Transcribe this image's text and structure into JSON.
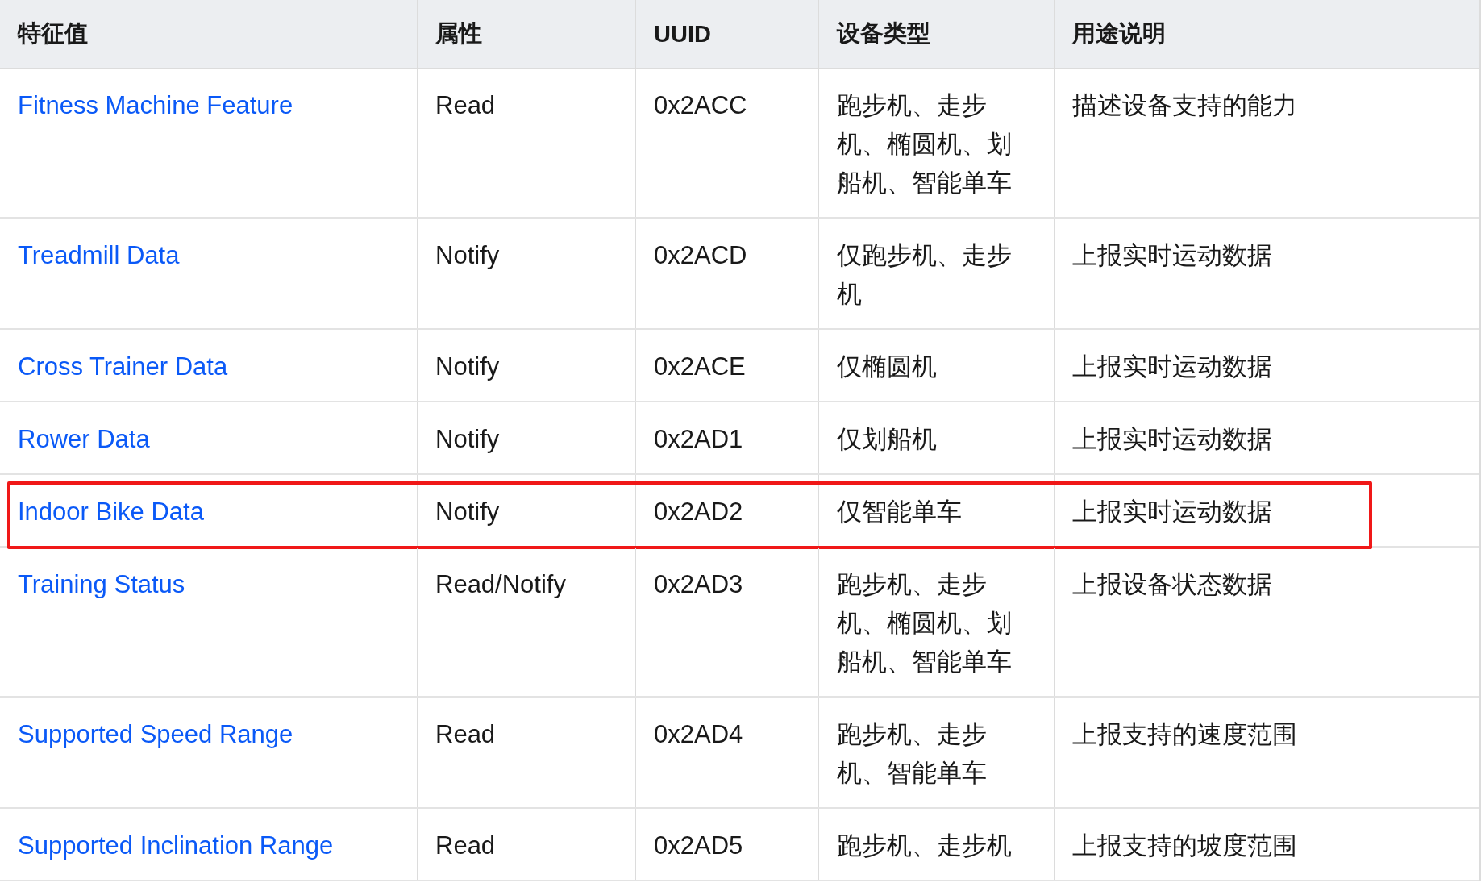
{
  "table": {
    "columns": [
      "特征值",
      "属性",
      "UUID",
      "设备类型",
      "用途说明"
    ],
    "rows": [
      {
        "name": "Fitness Machine Feature",
        "property": "Read",
        "uuid": "0x2ACC",
        "devices": "跑步机、走步机、椭圆机、划船机、智能单车",
        "purpose": "描述设备支持的能力",
        "highlighted": false
      },
      {
        "name": "Treadmill Data",
        "property": "Notify",
        "uuid": "0x2ACD",
        "devices": "仅跑步机、走步机",
        "purpose": "上报实时运动数据",
        "highlighted": false
      },
      {
        "name": "Cross Trainer Data",
        "property": "Notify",
        "uuid": "0x2ACE",
        "devices": "仅椭圆机",
        "purpose": "上报实时运动数据",
        "highlighted": false
      },
      {
        "name": "Rower Data",
        "property": "Notify",
        "uuid": "0x2AD1",
        "devices": "仅划船机",
        "purpose": "上报实时运动数据",
        "highlighted": false
      },
      {
        "name": "Indoor Bike Data",
        "property": "Notify",
        "uuid": "0x2AD2",
        "devices": "仅智能单车",
        "purpose": "上报实时运动数据",
        "highlighted": true
      },
      {
        "name": "Training Status",
        "property": "Read/Notify",
        "uuid": "0x2AD3",
        "devices": "跑步机、走步机、椭圆机、划船机、智能单车",
        "purpose": "上报设备状态数据",
        "highlighted": false
      },
      {
        "name": "Supported Speed Range",
        "property": "Read",
        "uuid": "0x2AD4",
        "devices": "跑步机、走步机、智能单车",
        "purpose": "上报支持的速度范围",
        "highlighted": false
      },
      {
        "name": "Supported Inclination Range",
        "property": "Read",
        "uuid": "0x2AD5",
        "devices": "跑步机、走步机",
        "purpose": "上报支持的坡度范围",
        "highlighted": false
      }
    ]
  }
}
